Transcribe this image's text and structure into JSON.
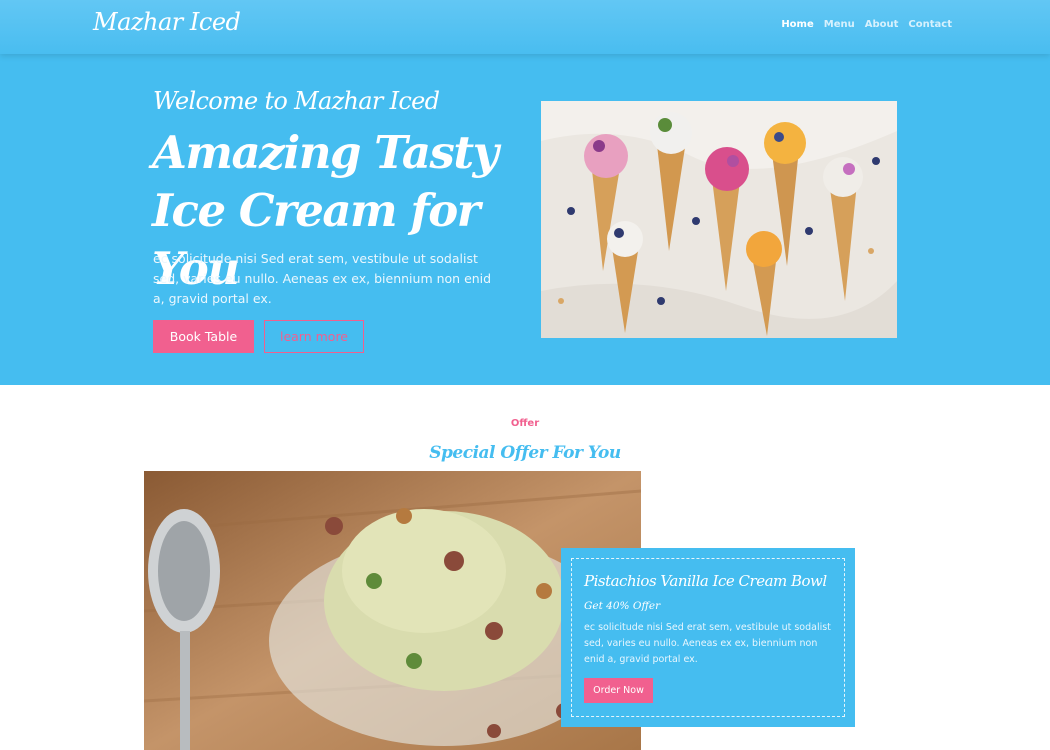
{
  "brand": "Mazhar Iced",
  "nav": [
    "Home",
    "Menu",
    "About",
    "Contact"
  ],
  "hero": {
    "welcome": "Welcome to Mazhar Iced",
    "title": "Amazing Tasty Ice Cream for You",
    "text": "ec solicitude nisi Sed erat sem, vestibule ut sodalist sed, varies eu nullo. Aeneas ex ex, biennium non enid a, gravid portal ex.",
    "book_label": "Book Table",
    "more_label": "learn more"
  },
  "offer": {
    "kicker": "Offer",
    "heading": "Special Offer For You",
    "card_title": "Pistachios Vanilla Ice Cream Bowl",
    "card_sub": "Get 40% Offer",
    "card_text": "ec solicitude nisi Sed erat sem, vestibule ut sodalist sed, varies eu nullo. Aeneas ex ex, biennium non enid a, gravid portal ex.",
    "order_label": "Order Now"
  },
  "colors": {
    "primary": "#45bdf0",
    "accent": "#f1608f"
  }
}
